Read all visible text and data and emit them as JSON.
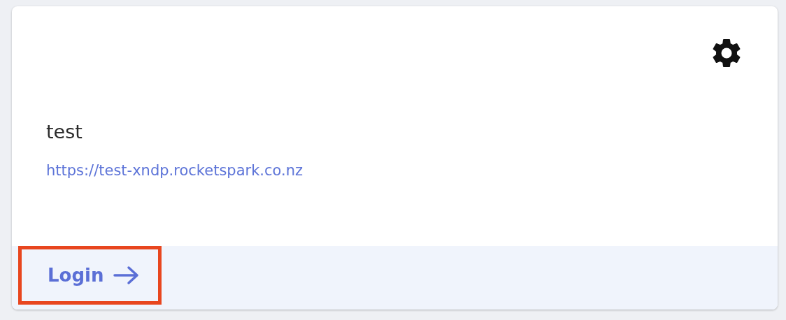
{
  "site": {
    "name": "test",
    "url": "https://test-xndp.rocketspark.co.nz"
  },
  "login": {
    "label": "Login",
    "highlighted": true
  }
}
